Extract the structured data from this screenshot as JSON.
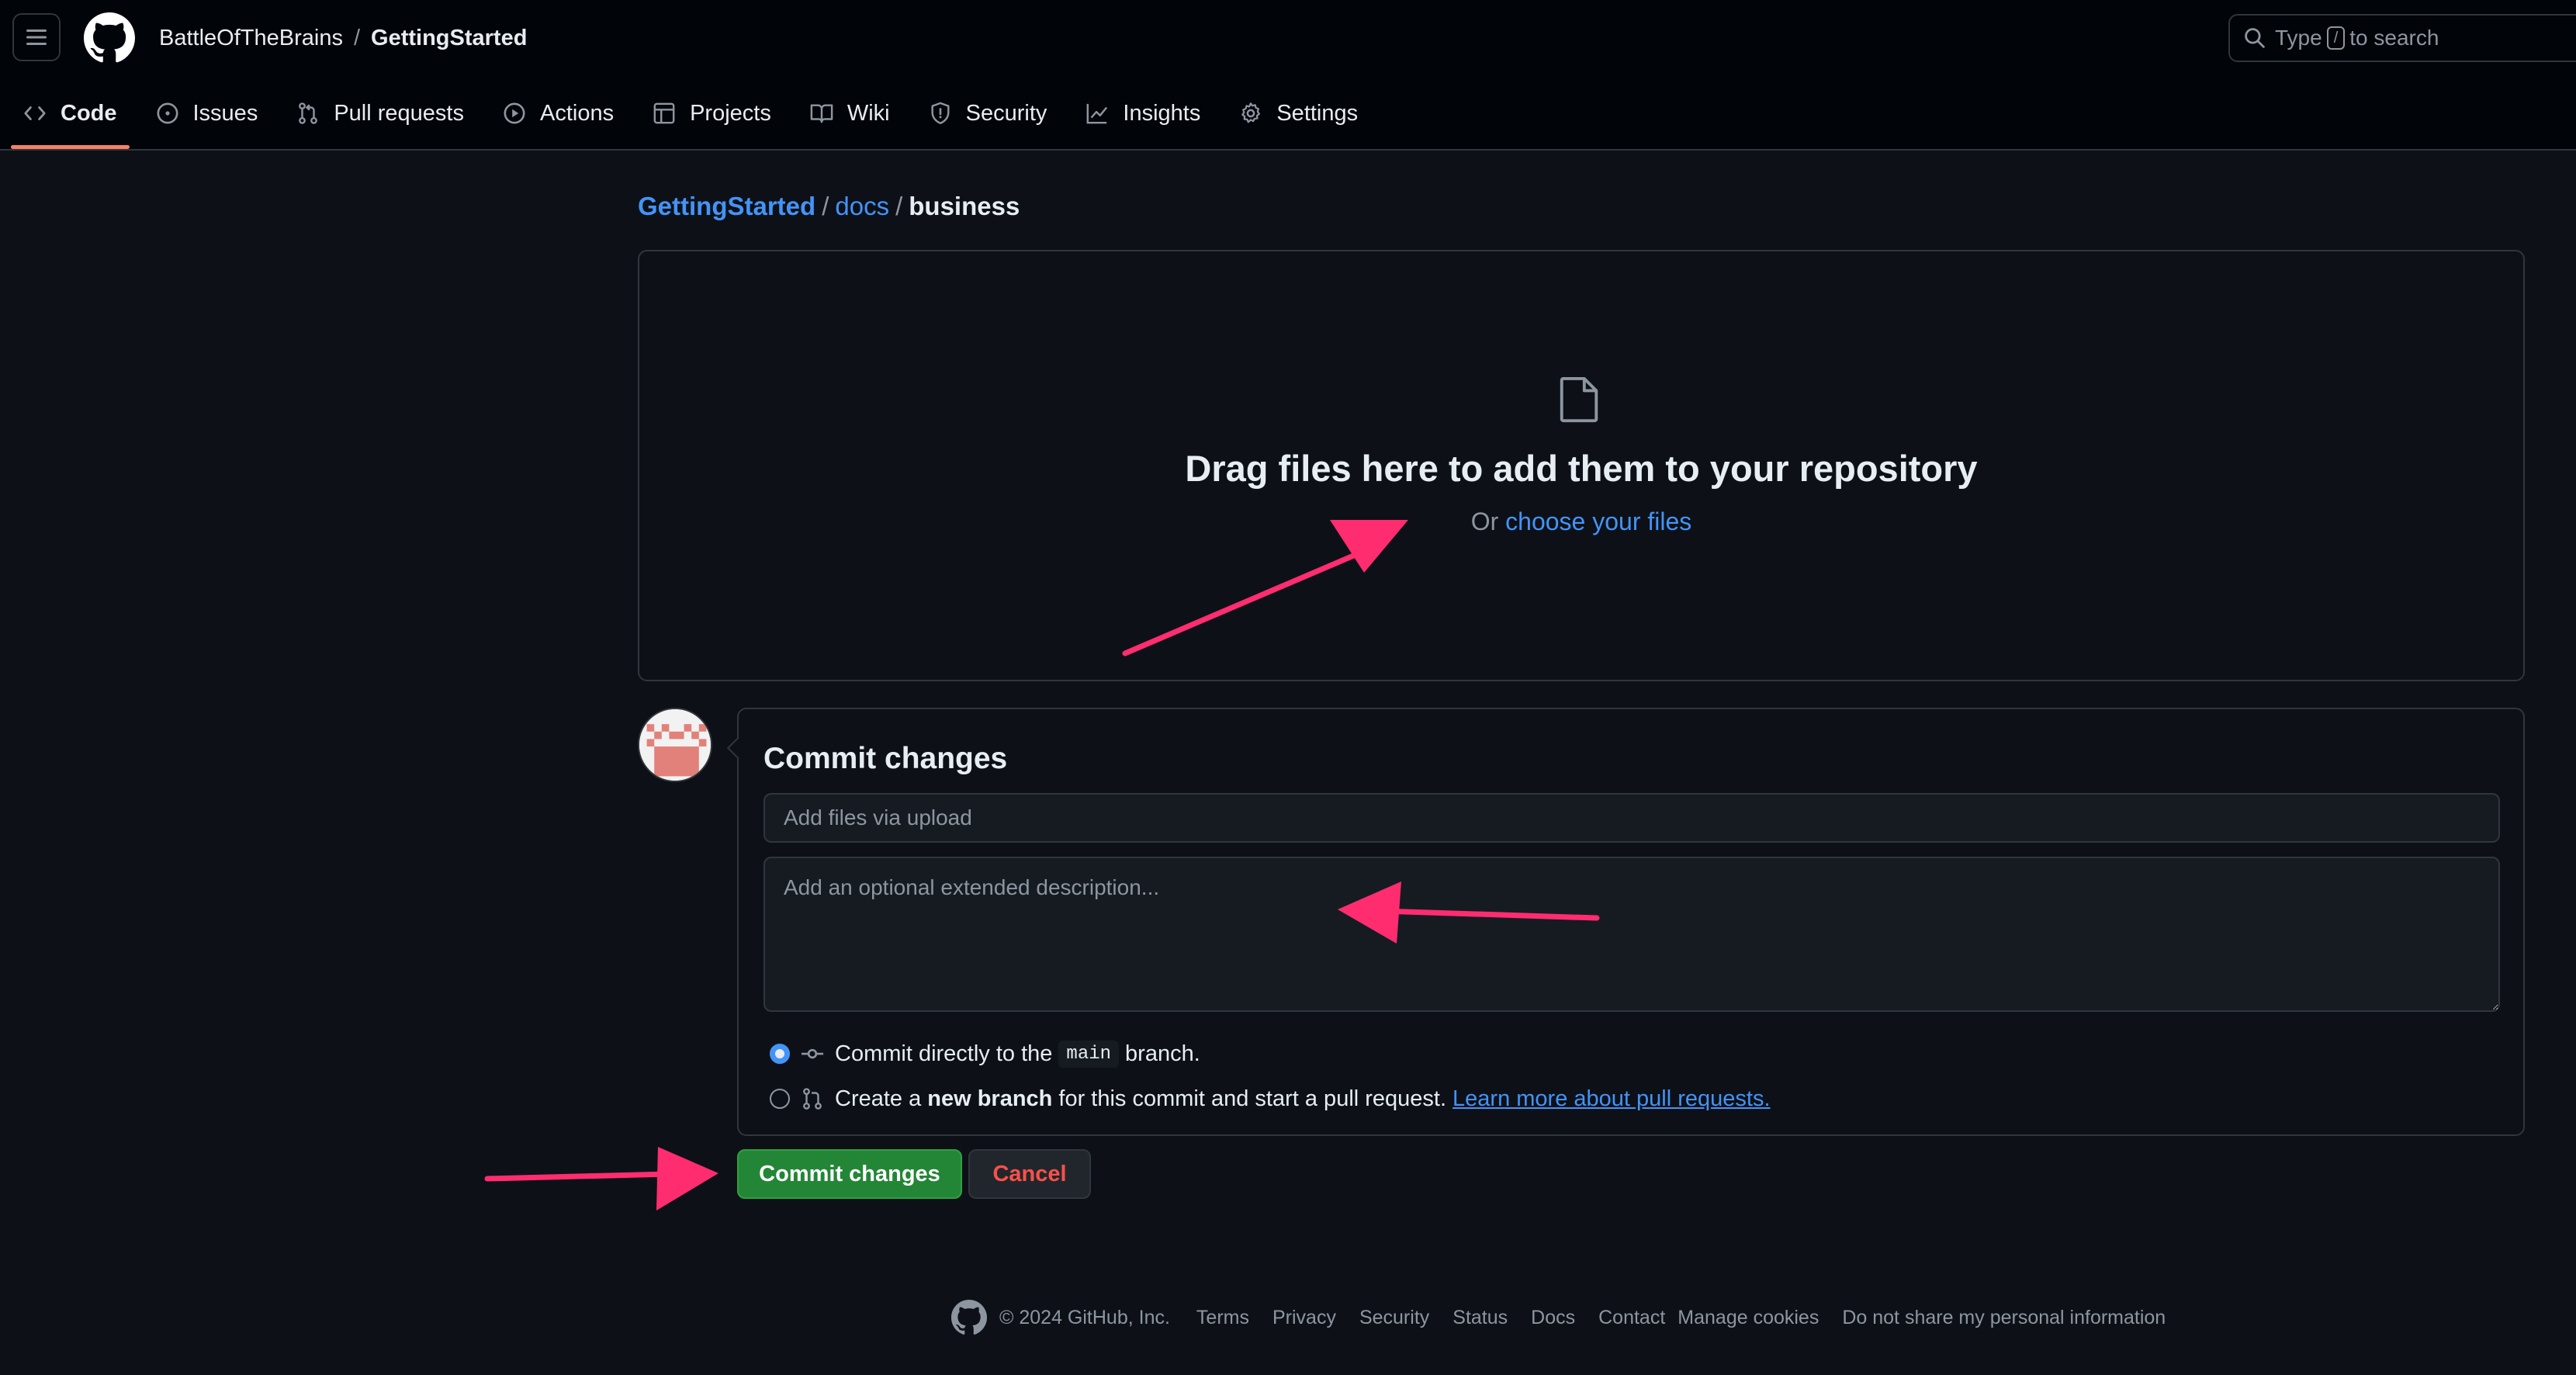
{
  "header": {
    "owner": "BattleOfTheBrains",
    "separator": "/",
    "repo": "GettingStarted",
    "search": {
      "before": "Type",
      "kbd": "/",
      "after": "to search"
    }
  },
  "nav": {
    "items": [
      {
        "label": "Code",
        "icon": "code-icon"
      },
      {
        "label": "Issues",
        "icon": "issue-icon"
      },
      {
        "label": "Pull requests",
        "icon": "pull-request-icon"
      },
      {
        "label": "Actions",
        "icon": "play-icon"
      },
      {
        "label": "Projects",
        "icon": "table-icon"
      },
      {
        "label": "Wiki",
        "icon": "book-icon"
      },
      {
        "label": "Security",
        "icon": "shield-icon"
      },
      {
        "label": "Insights",
        "icon": "graph-icon"
      },
      {
        "label": "Settings",
        "icon": "gear-icon"
      }
    ],
    "active": "Code"
  },
  "breadcrumb": {
    "root": "GettingStarted",
    "folder": "docs",
    "current": "business",
    "sep": "/"
  },
  "dropzone": {
    "title": "Drag files here to add them to your repository",
    "or": "Or",
    "link": "choose your files"
  },
  "commit": {
    "title": "Commit changes",
    "summary_placeholder": "Add files via upload",
    "description_placeholder": "Add an optional extended description...",
    "option_direct": {
      "before": "Commit directly to the",
      "branch": "main",
      "after": "branch."
    },
    "option_new": {
      "before": "Create a",
      "bold": "new branch",
      "after": "for this commit and start a pull request.",
      "link": "Learn more about pull requests."
    },
    "selected_option": "direct",
    "commit_button": "Commit changes",
    "cancel_button": "Cancel"
  },
  "footer": {
    "copyright": "© 2024 GitHub, Inc.",
    "links": [
      "Terms",
      "Privacy",
      "Security",
      "Status",
      "Docs",
      "Contact",
      "Manage cookies",
      "Do not share my personal information"
    ]
  },
  "colors": {
    "background": "#0d1117",
    "header_bg": "#010409",
    "link": "#4493f8",
    "commit_button": "#238636",
    "cancel_text": "#f85149",
    "active_tab_underline": "#f78166",
    "annotation_arrow": "#ff2d6f"
  }
}
